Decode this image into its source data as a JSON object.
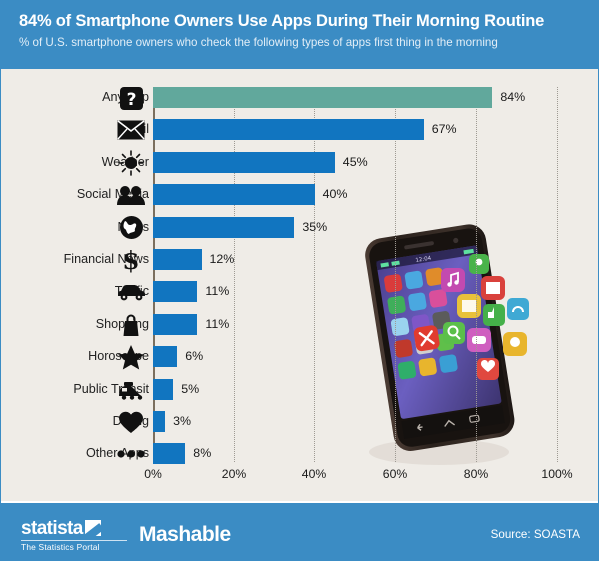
{
  "header": {
    "title": "84% of Smartphone Owners Use Apps During Their Morning Routine",
    "subtitle": "% of U.S. smartphone owners who check the following types of apps first thing in the morning"
  },
  "footer": {
    "statista_name": "statista",
    "statista_tagline": "The Statistics Portal",
    "partner": "Mashable",
    "source": "Source: SOASTA"
  },
  "colors": {
    "header_bg": "#3b8cc4",
    "body_bg": "#efece7",
    "bar": "#1175c0",
    "bar_highlight": "#61a89c",
    "text": "#222222"
  },
  "chart_data": {
    "type": "bar",
    "orientation": "horizontal",
    "title": "84% of Smartphone Owners Use Apps During Their Morning Routine",
    "subtitle": "% of U.S. smartphone owners who check the following types of apps first thing in the morning",
    "xlabel": "",
    "ylabel": "",
    "xlim": [
      0,
      100
    ],
    "grid": true,
    "legend": "none",
    "tick_labels": [
      "0%",
      "20%",
      "40%",
      "60%",
      "80%",
      "100%"
    ],
    "ticks": [
      0,
      20,
      40,
      60,
      80,
      100
    ],
    "categories": [
      "Any App",
      "Email",
      "Weather",
      "Social Media",
      "News",
      "Financial News",
      "Traffic",
      "Shopping",
      "Horoscope",
      "Public Transit",
      "Dating",
      "Other Apps"
    ],
    "values": [
      84,
      67,
      45,
      40,
      35,
      12,
      11,
      11,
      6,
      5,
      3,
      8
    ],
    "value_labels": [
      "84%",
      "67%",
      "45%",
      "40%",
      "35%",
      "12%",
      "11%",
      "11%",
      "6%",
      "5%",
      "3%",
      "8%"
    ],
    "highlight_index": 0,
    "icons": [
      "question-mark-icon",
      "envelope-icon",
      "sun-icon",
      "people-icon",
      "globe-icon",
      "dollar-sign-icon",
      "car-icon",
      "shopping-bag-icon",
      "star-icon",
      "train-icon",
      "heart-icon",
      "ellipsis-icon"
    ]
  }
}
